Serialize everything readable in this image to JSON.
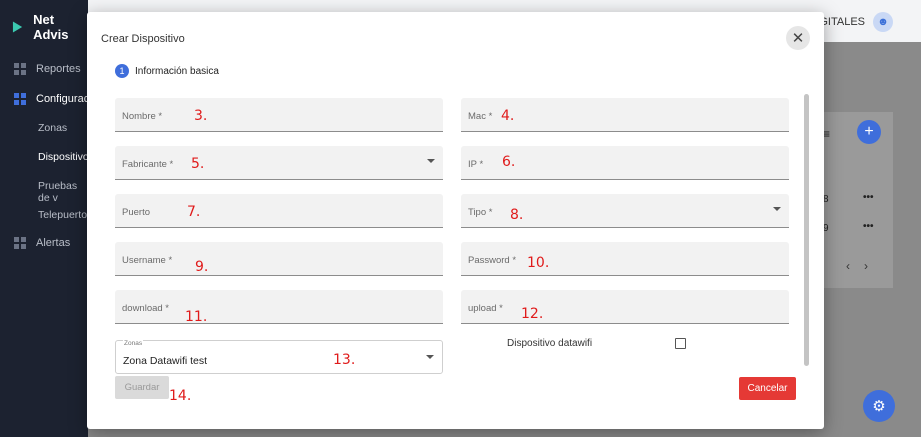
{
  "app": {
    "brand": "Net Advis",
    "sidebar": {
      "reportes": "Reportes",
      "configuracion": "Configuració",
      "zonas": "Zonas",
      "dispositivos": "Dispositivos",
      "pruebas": "Pruebas de v",
      "telepuertos": "Telepuertos",
      "alertas": "Alertas"
    },
    "header_right": "DIGITALES",
    "background_rows": [
      "8",
      "9"
    ],
    "colors": {
      "accent": "#3f6edb",
      "danger": "#e53935",
      "sidebar": "#1c2230"
    }
  },
  "dialog": {
    "title": "Crear Dispositivo",
    "step": {
      "number": "1",
      "label": "Información basica"
    },
    "fields": {
      "nombre": "Nombre *",
      "mac": "Mac *",
      "fabricante": "Fabricante *",
      "ip": "IP *",
      "puerto": "Puerto",
      "tipo": "Tipo *",
      "username": "Username *",
      "password": "Password *",
      "download": "download *",
      "upload": "upload *"
    },
    "zonas": {
      "label": "Zonas",
      "value": "Zona Datawifi test"
    },
    "checkbox_label": "Dispositivo datawifi",
    "save_label": "Guardar",
    "cancel_label": "Cancelar"
  },
  "annotations": {
    "a3": "3.",
    "a4": "4.",
    "a5": "5.",
    "a6": "6.",
    "a7": "7.",
    "a8": "8.",
    "a9": "9.",
    "a10": "10.",
    "a11": "11.",
    "a12": "12.",
    "a13": "13.",
    "a14": "14."
  }
}
